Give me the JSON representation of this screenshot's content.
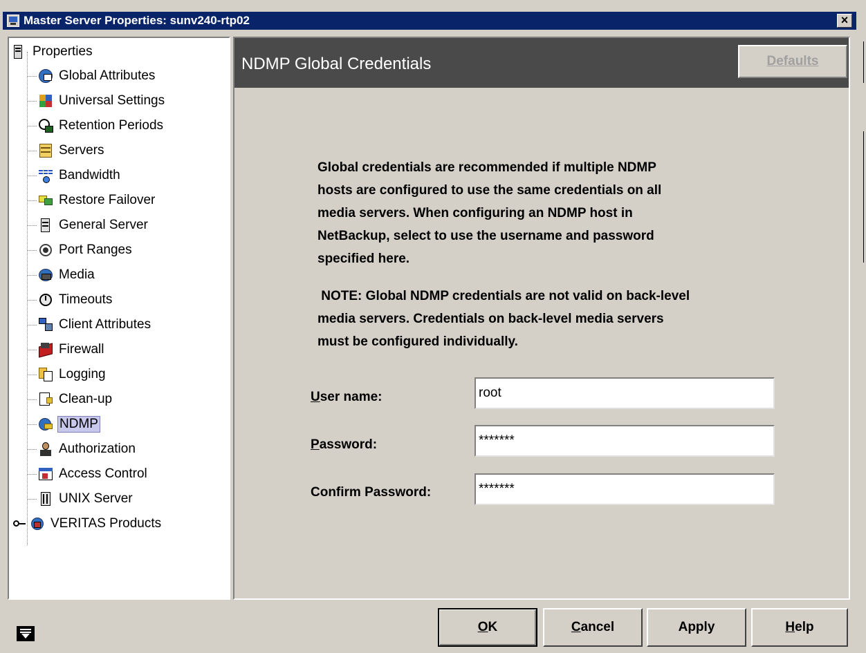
{
  "window": {
    "title": "Master Server Properties: sunv240-rtp02",
    "close_glyph": "×"
  },
  "tree": {
    "root_label": "Properties",
    "items": [
      {
        "label": "Global Attributes",
        "icon": "globe-icon"
      },
      {
        "label": "Universal Settings",
        "icon": "puzzle-icon"
      },
      {
        "label": "Retention Periods",
        "icon": "clock-icon"
      },
      {
        "label": "Servers",
        "icon": "server-icon"
      },
      {
        "label": "Bandwidth",
        "icon": "waveform-icon"
      },
      {
        "label": "Restore Failover",
        "icon": "failover-icon"
      },
      {
        "label": "General Server",
        "icon": "server-tower-icon"
      },
      {
        "label": "Port Ranges",
        "icon": "port-icon"
      },
      {
        "label": "Media",
        "icon": "media-icon"
      },
      {
        "label": "Timeouts",
        "icon": "timeout-icon"
      },
      {
        "label": "Client Attributes",
        "icon": "client-icon"
      },
      {
        "label": "Firewall",
        "icon": "firewall-icon"
      },
      {
        "label": "Logging",
        "icon": "logging-icon"
      },
      {
        "label": "Clean-up",
        "icon": "cleanup-icon"
      },
      {
        "label": "NDMP",
        "icon": "ndmp-icon",
        "selected": true
      },
      {
        "label": "Authorization",
        "icon": "user-icon"
      },
      {
        "label": "Access Control",
        "icon": "access-control-icon"
      },
      {
        "label": "UNIX Server",
        "icon": "unix-server-icon"
      }
    ],
    "extra_node": "VERITAS Products"
  },
  "panel": {
    "title": "NDMP Global Credentials",
    "defaults_label": "Defaults",
    "description_lines": [
      "Global credentials are recommended if multiple NDMP",
      "hosts are configured to use the same credentials on all",
      "media servers. When configuring an NDMP host in",
      "NetBackup, select to use the username and password",
      "specified here."
    ],
    "note_lines": [
      " NOTE: Global NDMP credentials are not valid on back-level",
      "media servers. Credentials on back-level media servers",
      "must be configured individually."
    ],
    "username": {
      "mnemonic": "U",
      "rest": "ser name:",
      "value": "root"
    },
    "password": {
      "mnemonic": "P",
      "rest": "assword:",
      "value": "*******"
    },
    "confirm": {
      "label": "Confirm Password:",
      "value": "*******"
    }
  },
  "buttons": {
    "ok": {
      "mnemonic": "O",
      "rest": "K"
    },
    "cancel": {
      "mnemonic": "C",
      "rest": "ancel"
    },
    "apply": {
      "mnemonic": "",
      "label": "Apply"
    },
    "help": {
      "mnemonic": "H",
      "rest": "elp"
    }
  },
  "colors": {
    "title_bar": "#0a246a",
    "banner": "#4a4a4a",
    "window_bg": "#d4d0c8",
    "selection": "#c8c8ec"
  }
}
